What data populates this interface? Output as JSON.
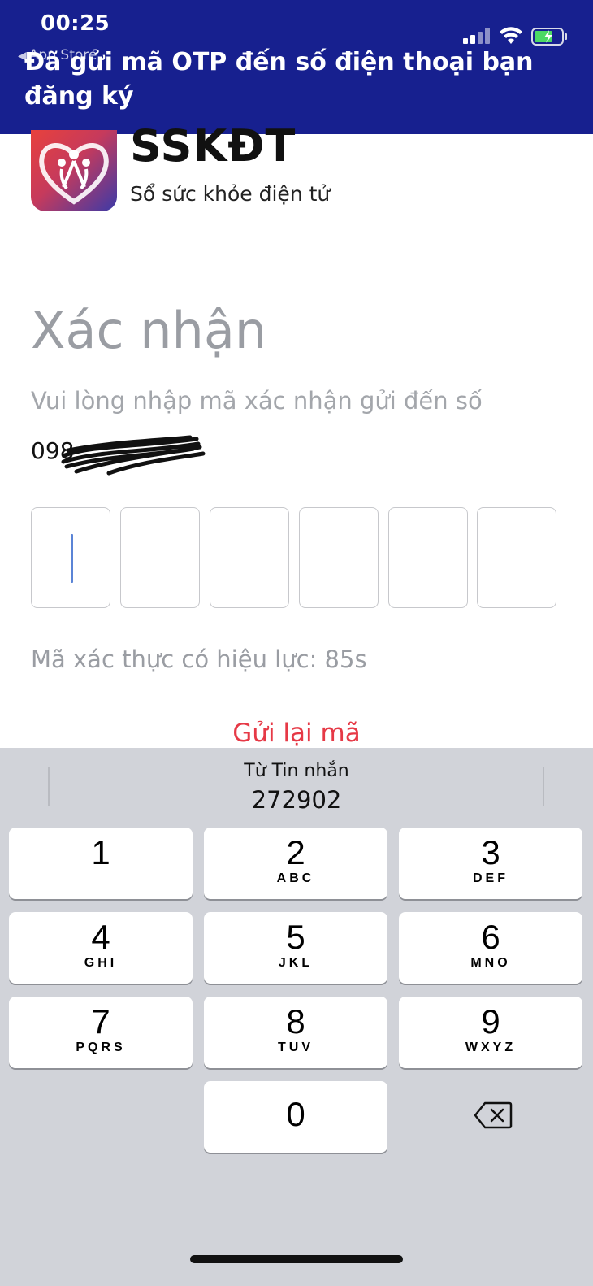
{
  "status": {
    "time": "00:25",
    "back_app": "App Store"
  },
  "banner": {
    "message": "Đã gửi mã OTP đến số điện thoại bạn đăng ký"
  },
  "app": {
    "name": "SSKĐT",
    "subtitle": "Sổ sức khỏe điện tử"
  },
  "verify": {
    "title": "Xác nhận",
    "instruction": "Vui lòng nhập mã xác nhận gửi đến số",
    "phone_visible": "098",
    "otp_digits": [
      "",
      "",
      "",
      "",
      "",
      ""
    ],
    "validity": "Mã xác thực có hiệu lực: 85s",
    "resend": "Gửi lại mã"
  },
  "keyboard": {
    "suggestion_source": "Từ Tin nhắn",
    "suggestion_code": "272902",
    "keys": [
      {
        "num": "1",
        "letters": ""
      },
      {
        "num": "2",
        "letters": "ABC"
      },
      {
        "num": "3",
        "letters": "DEF"
      },
      {
        "num": "4",
        "letters": "GHI"
      },
      {
        "num": "5",
        "letters": "JKL"
      },
      {
        "num": "6",
        "letters": "MNO"
      },
      {
        "num": "7",
        "letters": "PQRS"
      },
      {
        "num": "8",
        "letters": "TUV"
      },
      {
        "num": "9",
        "letters": "WXYZ"
      },
      {
        "num": "0",
        "letters": ""
      }
    ]
  },
  "colors": {
    "banner": "#17208f",
    "accent_red": "#e63946",
    "muted_text": "#9a9da3",
    "keyboard_bg": "#d1d3d9"
  }
}
